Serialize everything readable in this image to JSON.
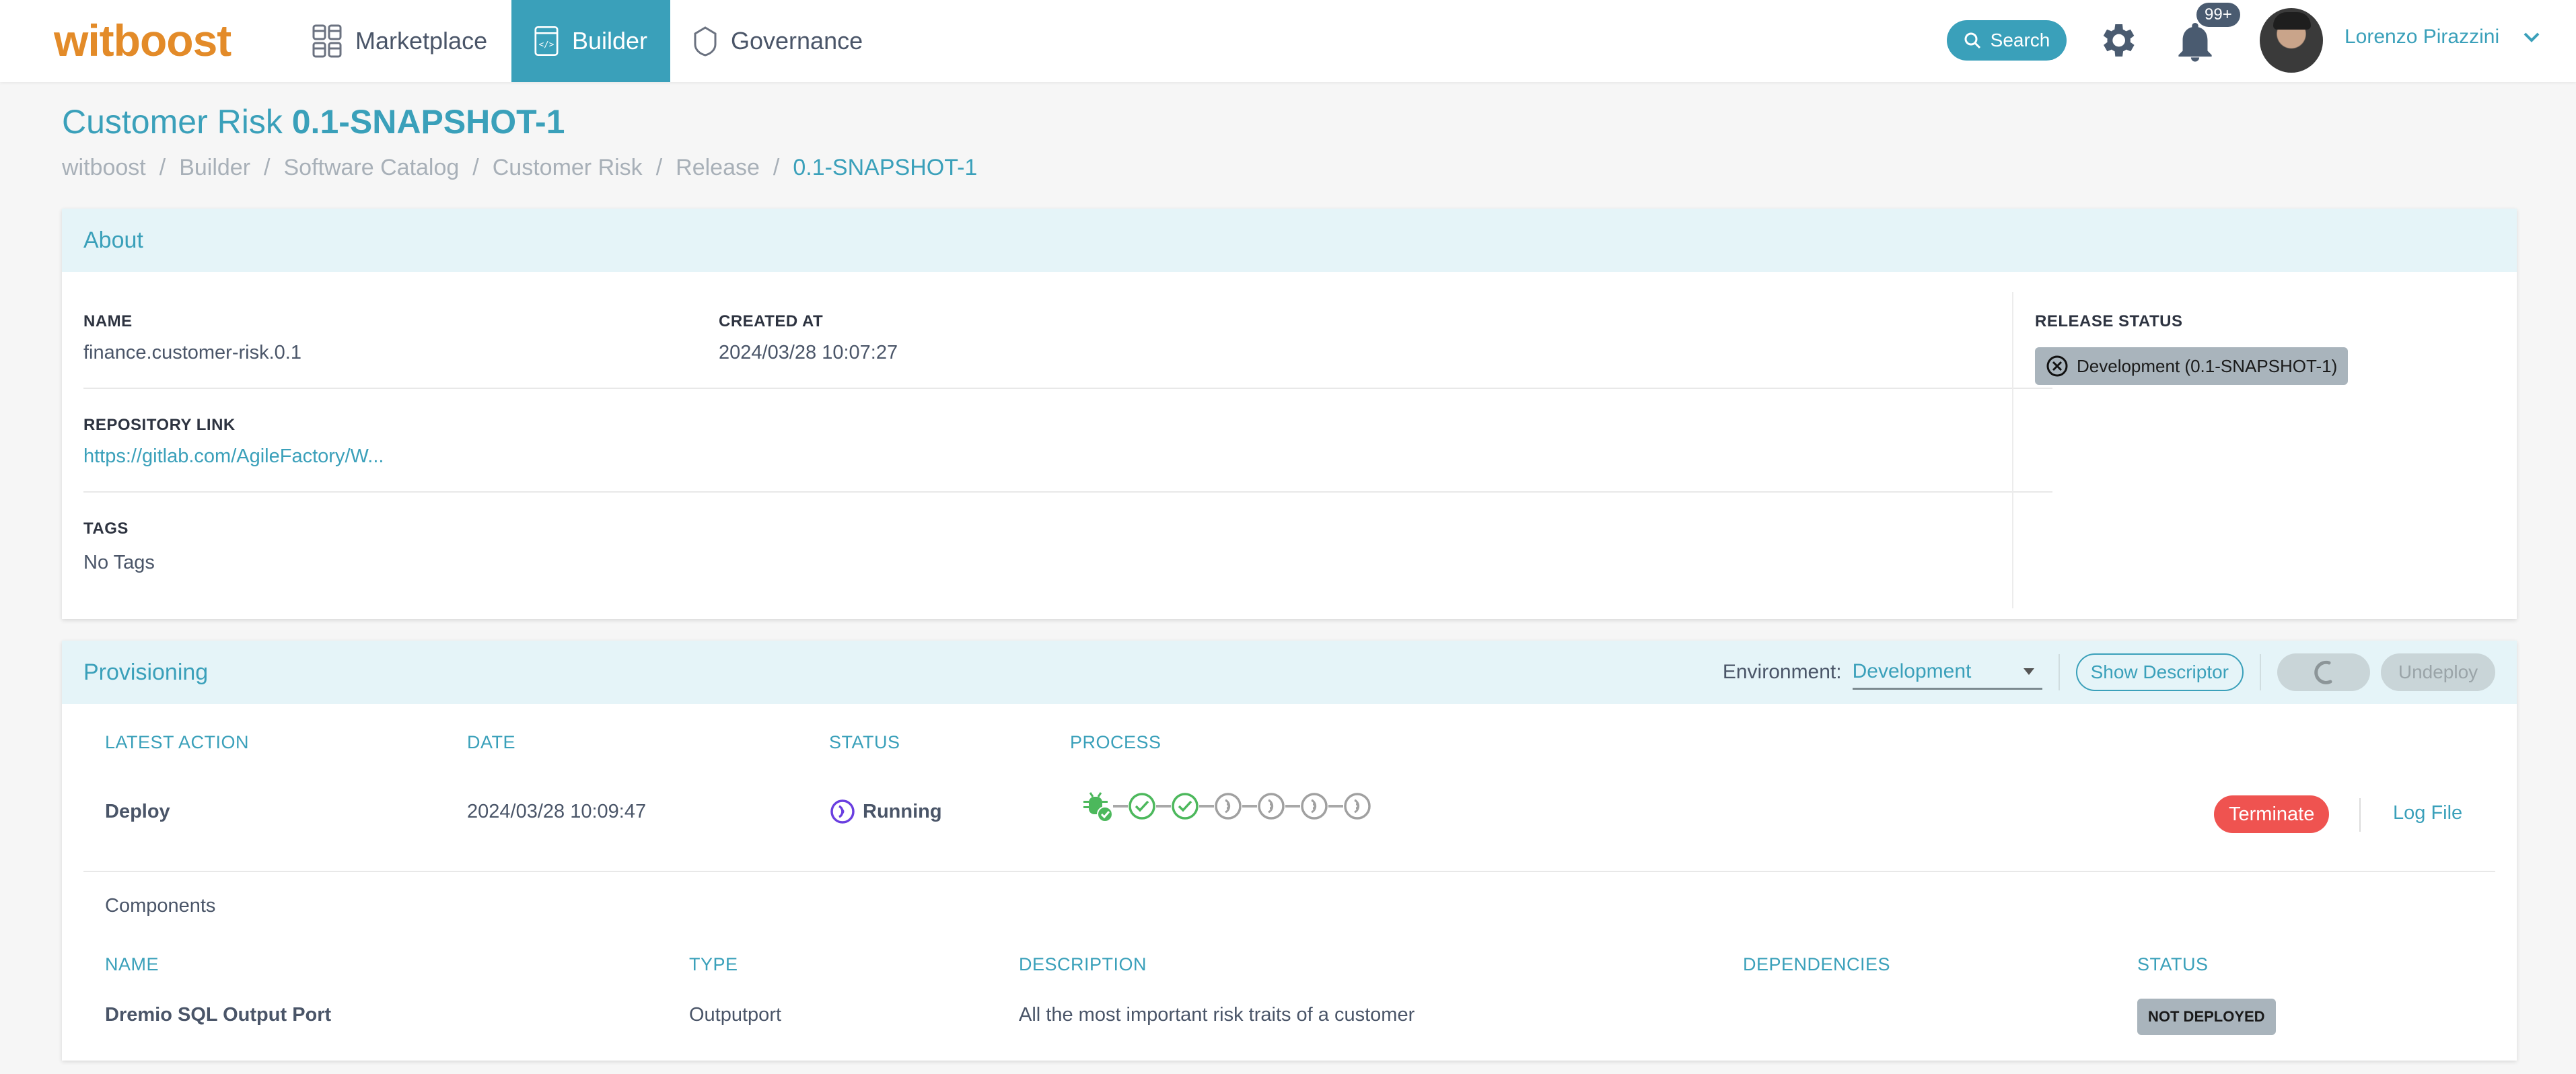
{
  "nav": {
    "logo": "witboost",
    "items": [
      {
        "label": "Marketplace",
        "icon": "grid-icon",
        "active": false
      },
      {
        "label": "Builder",
        "icon": "code-window-icon",
        "active": true
      },
      {
        "label": "Governance",
        "icon": "shield-icon",
        "active": false
      }
    ],
    "search_label": "Search",
    "notifications_badge": "99+",
    "user_name": "Lorenzo Pirazzini"
  },
  "page": {
    "title_prefix": "Customer Risk",
    "title_version": "0.1-SNAPSHOT-1",
    "breadcrumb": [
      "witboost",
      "Builder",
      "Software Catalog",
      "Customer Risk",
      "Release",
      "0.1-SNAPSHOT-1"
    ]
  },
  "about": {
    "header": "About",
    "name_label": "NAME",
    "name_value": "finance.customer-risk.0.1",
    "created_label": "CREATED AT",
    "created_value": "2024/03/28 10:07:27",
    "repo_label": "REPOSITORY LINK",
    "repo_value": "https://gitlab.com/AgileFactory/W...",
    "tags_label": "TAGS",
    "tags_value": "No Tags",
    "release_status_label": "RELEASE STATUS",
    "release_status_value": "Development (0.1-SNAPSHOT-1)"
  },
  "provisioning": {
    "header": "Provisioning",
    "environment_label": "Environment:",
    "environment_value": "Development",
    "show_descriptor_label": "Show Descriptor",
    "undeploy_label": "Undeploy",
    "columns": [
      "LATEST ACTION",
      "DATE",
      "STATUS",
      "PROCESS"
    ],
    "row": {
      "action": "Deploy",
      "date": "2024/03/28 10:09:47",
      "status": "Running",
      "process_steps": [
        "validated",
        "completed",
        "completed",
        "pending",
        "pending",
        "pending",
        "pending"
      ]
    },
    "terminate_label": "Terminate",
    "log_file_label": "Log File",
    "components": {
      "title": "Components",
      "columns": [
        "NAME",
        "TYPE",
        "DESCRIPTION",
        "DEPENDENCIES",
        "STATUS"
      ],
      "rows": [
        {
          "name": "Dremio SQL Output Port",
          "type": "Outputport",
          "description": "All the most important risk traits of a customer",
          "dependencies": "",
          "status": "NOT DEPLOYED"
        }
      ]
    }
  },
  "colors": {
    "accent": "#3aa0ba",
    "logo": "#e38b29",
    "success": "#4cb85c",
    "danger": "#ef5350",
    "running": "#6a3fe0",
    "chip": "#a9b4bc"
  }
}
